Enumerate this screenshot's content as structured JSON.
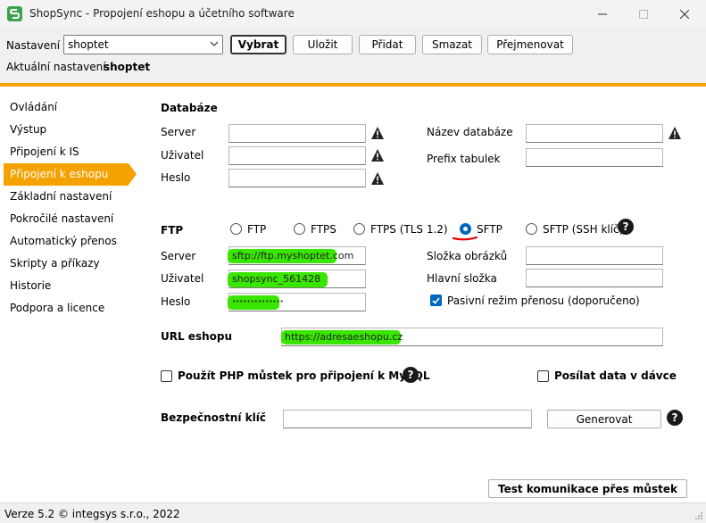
{
  "window": {
    "title": "ShopSync - Propojení eshopu a účetního software"
  },
  "toolbar": {
    "nastaveni_label": "Nastavení",
    "profile_value": "shoptet",
    "buttons": {
      "vybrat": "Vybrat",
      "ulozit": "Uložit",
      "pridat": "Přidat",
      "smazat": "Smazat",
      "prejmenovat": "Přejmenovat"
    },
    "current_label": "Aktuální nastavení:",
    "current_value": "shoptet"
  },
  "sidebar": {
    "items": [
      {
        "label": "Ovládání"
      },
      {
        "label": "Výstup"
      },
      {
        "label": "Připojení k IS"
      },
      {
        "label": "Připojení k eshopu",
        "active": true
      },
      {
        "label": "Základní nastavení"
      },
      {
        "label": "Pokročilé nastavení"
      },
      {
        "label": "Automatický přenos"
      },
      {
        "label": "Skripty a příkazy"
      },
      {
        "label": "Historie"
      },
      {
        "label": "Podpora a licence"
      }
    ]
  },
  "database": {
    "heading": "Databáze",
    "server_label": "Server",
    "server_value": "",
    "user_label": "Uživatel",
    "user_value": "",
    "password_label": "Heslo",
    "password_value": "",
    "dbname_label": "Název databáze",
    "dbname_value": "",
    "prefix_label": "Prefix tabulek",
    "prefix_value": ""
  },
  "ftp": {
    "heading": "FTP",
    "protocols": [
      {
        "label": "FTP",
        "selected": false
      },
      {
        "label": "FTPS",
        "selected": false
      },
      {
        "label": "FTPS (TLS 1.2)",
        "selected": false
      },
      {
        "label": "SFTP",
        "selected": true
      },
      {
        "label": "SFTP (SSH klíč)",
        "selected": false
      }
    ],
    "server_label": "Server",
    "server_value": "sftp://ftp.myshoptet.com",
    "user_label": "Uživatel",
    "user_value": "shopsync_561428",
    "password_label": "Heslo",
    "password_value": "••••••••••••••",
    "images_label": "Složka obrázků",
    "images_value": "",
    "main_label": "Hlavní složka",
    "main_value": "",
    "passive_label": "Pasivní režim přenosu (doporučeno)",
    "passive_checked": true
  },
  "url": {
    "label": "URL eshopu",
    "value": "https://adresaeshopu.cz"
  },
  "options": {
    "php_bridge_label": "Použít PHP můstek pro připojení k MySQL",
    "php_bridge_checked": false,
    "batch_label": "Posílat data v dávce",
    "batch_checked": false
  },
  "security": {
    "label": "Bezpečnostní klíč",
    "value": "",
    "generate_button": "Generovat"
  },
  "test_button": "Test komunikace přes můstek",
  "status": {
    "version": "Verze 5.2  © integsys s.r.o., 2022"
  },
  "colors": {
    "accent": "#f5a100",
    "highlight": "#39e600",
    "radio_selected": "#0067c0"
  }
}
